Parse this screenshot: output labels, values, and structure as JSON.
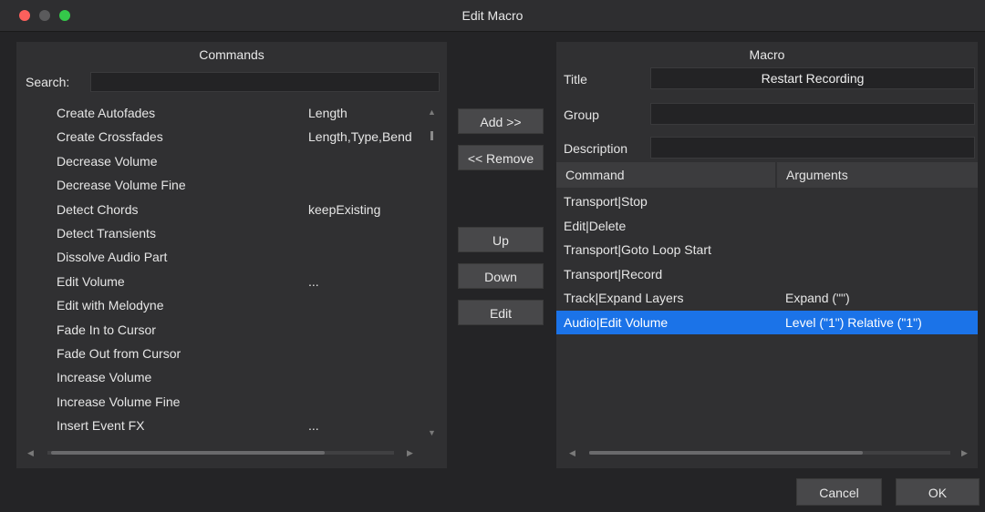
{
  "window": {
    "title": "Edit Macro"
  },
  "commands": {
    "header": "Commands",
    "search_label": "Search:",
    "search_value": "",
    "items": [
      {
        "name": "Create Autofades",
        "args": "Length"
      },
      {
        "name": "Create Crossfades",
        "args": "Length,Type,Bend"
      },
      {
        "name": "Decrease Volume",
        "args": ""
      },
      {
        "name": "Decrease Volume Fine",
        "args": ""
      },
      {
        "name": "Detect Chords",
        "args": "keepExisting"
      },
      {
        "name": "Detect Transients",
        "args": ""
      },
      {
        "name": "Dissolve Audio Part",
        "args": ""
      },
      {
        "name": "Edit Volume",
        "args": "..."
      },
      {
        "name": "Edit with Melodyne",
        "args": ""
      },
      {
        "name": "Fade In to Cursor",
        "args": ""
      },
      {
        "name": "Fade Out from Cursor",
        "args": ""
      },
      {
        "name": "Increase Volume",
        "args": ""
      },
      {
        "name": "Increase Volume Fine",
        "args": ""
      },
      {
        "name": "Insert Event FX",
        "args": "..."
      }
    ]
  },
  "buttons": {
    "add": "Add >>",
    "remove": "<< Remove",
    "up": "Up",
    "down": "Down",
    "edit": "Edit",
    "cancel": "Cancel",
    "ok": "OK"
  },
  "macro": {
    "header": "Macro",
    "title_label": "Title",
    "title_value": "Restart Recording",
    "group_label": "Group",
    "group_value": "",
    "description_label": "Description",
    "description_value": "",
    "col_command": "Command",
    "col_arguments": "Arguments",
    "selected_index": 5,
    "selection_color": "#1b73e8",
    "rows": [
      {
        "command": "Transport|Stop",
        "args": ""
      },
      {
        "command": "Edit|Delete",
        "args": ""
      },
      {
        "command": "Transport|Goto Loop Start",
        "args": ""
      },
      {
        "command": "Transport|Record",
        "args": ""
      },
      {
        "command": "Track|Expand Layers",
        "args": "Expand (\"\")"
      },
      {
        "command": "Audio|Edit Volume",
        "args": "Level (\"1\") Relative (\"1\")"
      }
    ]
  }
}
